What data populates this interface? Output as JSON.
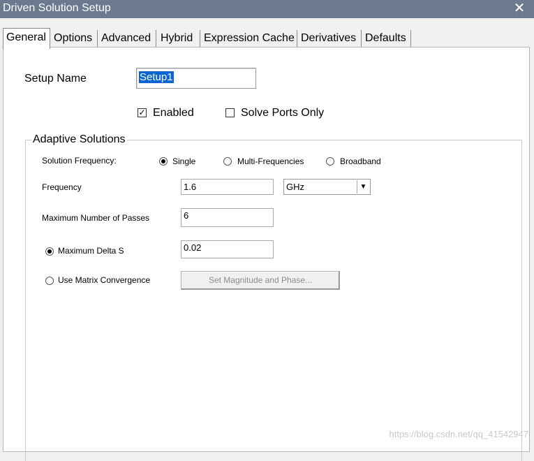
{
  "window": {
    "title": "Driven Solution Setup",
    "close_icon": "✕"
  },
  "tabs": [
    {
      "label": "General",
      "active": true
    },
    {
      "label": "Options"
    },
    {
      "label": "Advanced"
    },
    {
      "label": "Hybrid"
    },
    {
      "label": "Expression Cache"
    },
    {
      "label": "Derivatives"
    },
    {
      "label": "Defaults"
    }
  ],
  "general": {
    "setup_name_label": "Setup Name",
    "setup_name_value": "Setup1",
    "enabled_label": "Enabled",
    "enabled_checked": true,
    "solve_ports_only_label": "Solve Ports Only",
    "solve_ports_only_checked": false
  },
  "adaptive": {
    "title": "Adaptive Solutions",
    "solution_frequency_label": "Solution Frequency:",
    "options": [
      "Single",
      "Multi-Frequencies",
      "Broadband"
    ],
    "selected": "Single",
    "frequency_label": "Frequency",
    "frequency_value": "1.6",
    "frequency_unit": "GHz",
    "max_passes_label": "Maximum Number of Passes",
    "max_passes_value": "6",
    "max_delta_s_label": "Maximum Delta S",
    "max_delta_s_value": "0.02",
    "max_delta_s_selected": true,
    "matrix_convergence_label": "Use Matrix Convergence",
    "matrix_convergence_selected": false,
    "set_mag_phase_button": "Set Magnitude and Phase..."
  },
  "watermark": "https://blog.csdn.net/qq_41542947",
  "colors": {
    "titlebar": "#6b7a8f",
    "selection": "#0a64d2"
  }
}
